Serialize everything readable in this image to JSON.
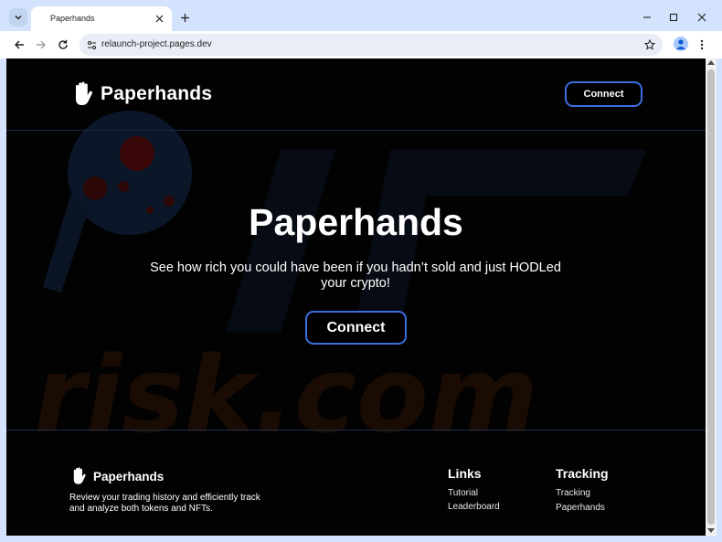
{
  "browser": {
    "tab_title": "Paperhands",
    "url": "relaunch-project.pages.dev"
  },
  "header": {
    "brand": "Paperhands",
    "connect_label": "Connect"
  },
  "hero": {
    "title": "Paperhands",
    "subtitle": "See how rich you could have been if you hadn’t sold and just HODLed your crypto!",
    "connect_label": "Connect"
  },
  "footer": {
    "brand": "Paperhands",
    "description": "Review your trading history and efficiently track and analyze both tokens and NFTs.",
    "links": {
      "title": "Links",
      "items": [
        "Tutorial",
        "Leaderboard"
      ]
    },
    "tracking": {
      "title": "Tracking",
      "items": [
        "Tracking",
        "Paperhands"
      ]
    }
  },
  "watermark": "risk.com",
  "colors": {
    "page_bg": "#020203",
    "accent_border": "#3b6fe0",
    "chrome_bg": "#d3e3fd"
  }
}
